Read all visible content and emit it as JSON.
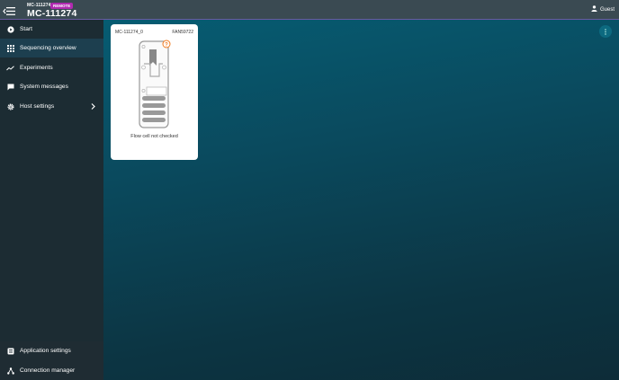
{
  "header": {
    "device_name_small": "MC-111274",
    "badge": "REMOTE",
    "device_name_large": "MC-111274",
    "user_label": "Guest"
  },
  "sidebar": {
    "items": [
      {
        "label": "Start",
        "icon": "play-circle-icon"
      },
      {
        "label": "Sequencing overview",
        "icon": "grid-icon",
        "active": true
      },
      {
        "label": "Experiments",
        "icon": "trend-line-icon"
      },
      {
        "label": "System messages",
        "icon": "chat-icon"
      },
      {
        "label": "Host settings",
        "icon": "gear-icon"
      }
    ],
    "bottom_items": [
      {
        "label": "Application settings",
        "icon": "app-settings-icon"
      },
      {
        "label": "Connection manager",
        "icon": "network-icon"
      }
    ]
  },
  "flow_cell": {
    "position": "MC-111274_0",
    "flow_cell_id": "FAN59722",
    "status": "Flow cell not checked"
  },
  "colors": {
    "topbar": "#3a4a52",
    "sidebar": "#1c2c33",
    "sidebar_active": "#1d3f4f",
    "badge": "#b02ab0",
    "warning": "#f07a1f"
  }
}
